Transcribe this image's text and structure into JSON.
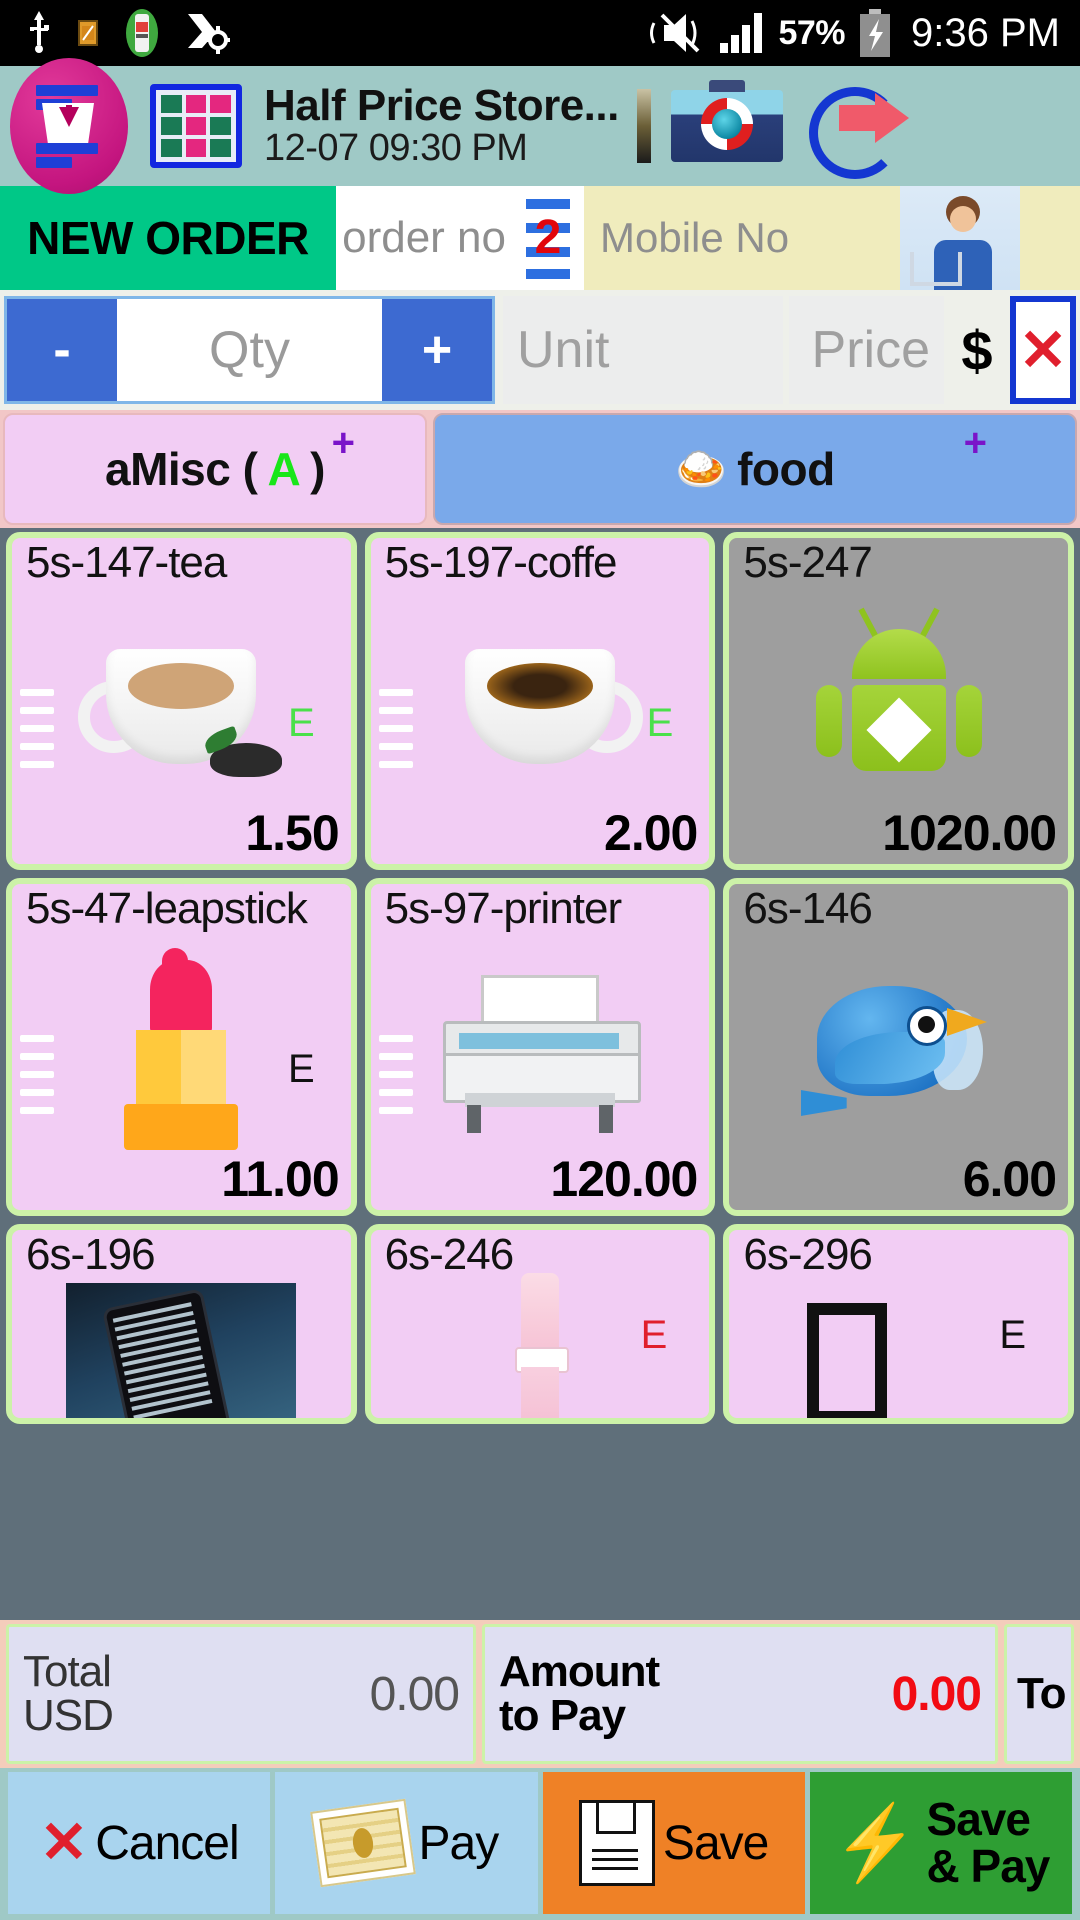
{
  "status_bar": {
    "icons": [
      "usb-icon",
      "sd-card-icon",
      "battery-saver-icon",
      "sync-settings-icon",
      "vibrate-off-icon",
      "signal-bars-icon"
    ],
    "battery_percent": "57%",
    "clock": "9:36 PM"
  },
  "app_header": {
    "logo_icon": "order-basket-icon",
    "grid_icon": "table-grid-icon",
    "title": "Half Price Store...",
    "datetime": "12-07 09:30 PM",
    "divider_icon": "pen-divider-icon",
    "camera_icon": "camera-icon",
    "exit_icon": "exit-arrow-icon"
  },
  "order_row": {
    "new_order_label": "NEW ORDER",
    "order_no_placeholder": "order no",
    "order_no_badge": "2",
    "mobile_no_placeholder": "Mobile No",
    "customer_icon": "customer-shopper-icon"
  },
  "qty_row": {
    "minus_label": "-",
    "qty_placeholder": "Qty",
    "plus_label": "+",
    "unit_placeholder": "Unit",
    "price_placeholder": "Price",
    "currency_symbol": "$",
    "clear_label": "✕"
  },
  "categories": [
    {
      "label": "aMisc (",
      "highlight": "A",
      "label_end": ")",
      "plus": "+",
      "selected": false,
      "color": "#f2cdf4"
    },
    {
      "label": "food",
      "emoji": "🍛",
      "plus": "+",
      "selected": true,
      "color": "#7aa9ea"
    }
  ],
  "products": [
    [
      {
        "name": "5s-147-tea",
        "price": "1.50",
        "badge": "E",
        "badge_color": "green",
        "bg": "pink",
        "art": "tea-cup-image",
        "ticks": true
      },
      {
        "name": "5s-197-coffe",
        "price": "2.00",
        "badge": "E",
        "badge_color": "green",
        "bg": "pink",
        "art": "coffee-cup-image",
        "ticks": true
      },
      {
        "name": "5s-247",
        "price": "1020.00",
        "badge": "",
        "badge_color": "none",
        "bg": "gray",
        "art": "android-robot-image",
        "ticks": false
      }
    ],
    [
      {
        "name": "5s-47-leapstick",
        "price": "11.00",
        "badge": "E",
        "badge_color": "dark",
        "bg": "pink",
        "art": "lipstick-image",
        "ticks": true
      },
      {
        "name": "5s-97-printer",
        "price": "120.00",
        "badge": "",
        "badge_color": "none",
        "bg": "pink",
        "art": "printer-image",
        "ticks": true
      },
      {
        "name": "6s-146",
        "price": "6.00",
        "badge": "",
        "badge_color": "none",
        "bg": "gray",
        "art": "blue-bird-image",
        "ticks": false
      }
    ],
    [
      {
        "name": "6s-196",
        "price": "",
        "badge": "",
        "badge_color": "none",
        "bg": "pink",
        "art": "phone-photo-image",
        "ticks": false
      },
      {
        "name": "6s-246",
        "price": "",
        "badge": "E",
        "badge_color": "red",
        "bg": "pink",
        "art": "pink-tube-image",
        "ticks": false
      },
      {
        "name": "6s-296",
        "price": "",
        "badge": "E",
        "badge_color": "dark",
        "bg": "pink",
        "art": "missing-glyph-box",
        "ticks": false
      }
    ]
  ],
  "totals": {
    "total_label_line1": "Total",
    "total_label_line2": "USD",
    "total_value": "0.00",
    "amount_label_line1": "Amount",
    "amount_label_line2": "to Pay",
    "amount_value": "0.00",
    "third_label": "To"
  },
  "actions": [
    {
      "label": "Cancel",
      "icon": "cancel-x-icon",
      "color": "#a9d4ee"
    },
    {
      "label": "Pay",
      "icon": "cash-money-icon",
      "color": "#a9d4ee"
    },
    {
      "label": "Save",
      "icon": "floppy-disk-icon",
      "color": "#ef8126"
    },
    {
      "label": "Save",
      "label2": "& Pay",
      "icon": "lightning-bolt-icon",
      "color": "#2e9e33"
    }
  ]
}
